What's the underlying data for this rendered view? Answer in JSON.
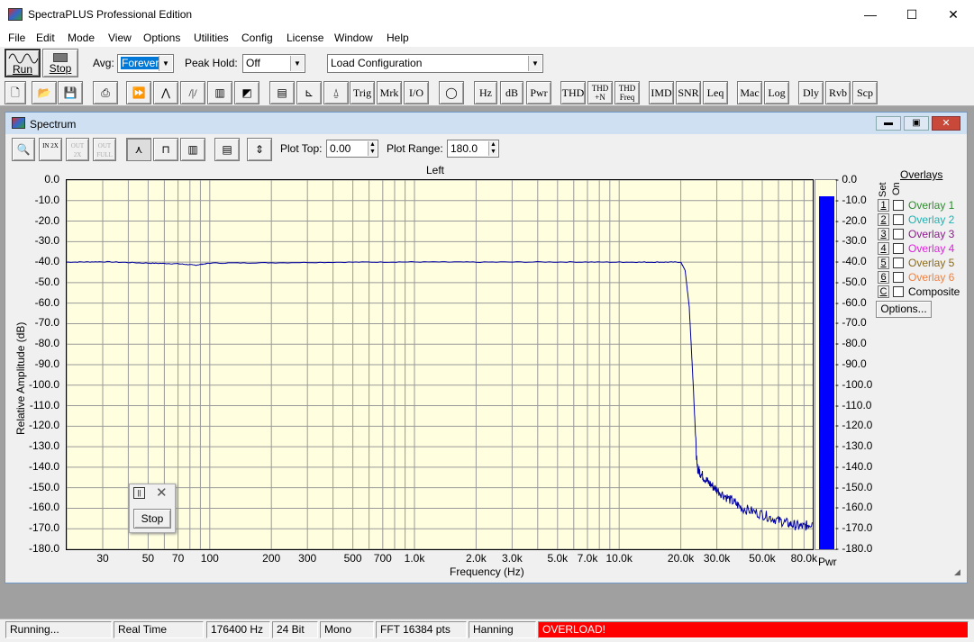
{
  "app": {
    "title": "SpectraPLUS Professional Edition",
    "minimize": "—",
    "maximize": "☐",
    "close": "✕"
  },
  "menu": [
    "File",
    "Edit",
    "Mode",
    "View",
    "Options",
    "Utilities",
    "Config",
    "License",
    "Window",
    "Help"
  ],
  "toolbar": {
    "run_label": "Run",
    "stop_label": "Stop",
    "avg_label": "Avg:",
    "avg_value": "Forever",
    "peak_hold_label": "Peak Hold:",
    "peak_hold_value": "Off",
    "config_value": "Load Configuration",
    "text_buttons": [
      "Trig",
      "Mrk",
      "I/O",
      "Hz",
      "dB",
      "Pwr",
      "THD",
      "THD\n+N",
      "THD\nFreq",
      "IMD",
      "SNR",
      "Leq",
      "Mac",
      "Log",
      "Dly",
      "Rvb",
      "Scp"
    ]
  },
  "spectrum": {
    "window_title": "Spectrum",
    "plot_top_label": "Plot Top:",
    "plot_top_value": "0.00",
    "plot_range_label": "Plot Range:",
    "plot_range_value": "180.0",
    "zoom_buttons": [
      "IN 2X",
      "OUT 2X",
      "OUT FULL"
    ],
    "chart_title": "Left",
    "pwr_label": "Pwr",
    "options_button": "Options...",
    "overlays_title": "Overlays",
    "set_label": "Set",
    "on_label": "On",
    "overlays": [
      {
        "key": "1",
        "label": "Overlay 1",
        "color": "#2e8b2e"
      },
      {
        "key": "2",
        "label": "Overlay 2",
        "color": "#20b0b0"
      },
      {
        "key": "3",
        "label": "Overlay 3",
        "color": "#8b1a8b"
      },
      {
        "key": "4",
        "label": "Overlay 4",
        "color": "#e020e0"
      },
      {
        "key": "5",
        "label": "Overlay 5",
        "color": "#8b6a1a"
      },
      {
        "key": "6",
        "label": "Overlay 6",
        "color": "#f08040"
      },
      {
        "key": "C",
        "label": "Composite",
        "color": "#000000"
      }
    ]
  },
  "floating_stop": {
    "button": "Stop"
  },
  "status": [
    "Running...",
    "Real Time",
    "176400 Hz",
    "24 Bit",
    "Mono",
    "FFT 16384 pts",
    "Hanning",
    "OVERLOAD!"
  ],
  "status_overload_color": "#ff0000",
  "chart_data": {
    "type": "line",
    "title": "Left",
    "xlabel": "Frequency (Hz)",
    "ylabel": "Relative Amplitude (dB)",
    "x_scale": "log",
    "xlim": [
      20,
      88200
    ],
    "ylim": [
      -180,
      0
    ],
    "x_ticks": [
      "30",
      "50",
      "70",
      "100",
      "200",
      "300",
      "500",
      "700",
      "1.0k",
      "2.0k",
      "3.0k",
      "5.0k",
      "7.0k",
      "10.0k",
      "20.0k",
      "30.0k",
      "50.0k",
      "80.0k"
    ],
    "x_tick_values": [
      30,
      50,
      70,
      100,
      200,
      300,
      500,
      700,
      1000,
      2000,
      3000,
      5000,
      7000,
      10000,
      20000,
      30000,
      50000,
      80000
    ],
    "y_ticks": [
      "0.0",
      "-10.0",
      "-20.0",
      "-30.0",
      "-40.0",
      "-50.0",
      "-60.0",
      "-70.0",
      "-80.0",
      "-90.0",
      "-100.0",
      "-110.0",
      "-120.0",
      "-130.0",
      "-140.0",
      "-150.0",
      "-160.0",
      "-170.0",
      "-180.0"
    ],
    "y_tick_values": [
      0,
      -10,
      -20,
      -30,
      -40,
      -50,
      -60,
      -70,
      -80,
      -90,
      -100,
      -110,
      -120,
      -130,
      -140,
      -150,
      -160,
      -170,
      -180
    ],
    "series": [
      {
        "color": "#0000a0",
        "x": [
          20,
          30,
          50,
          70,
          85,
          100,
          200,
          500,
          1000,
          2000,
          5000,
          10000,
          15000,
          20000,
          21000,
          22000,
          23000,
          24000,
          25000,
          27000,
          30000,
          35000,
          40000,
          50000,
          60000,
          70000,
          80000,
          88000
        ],
        "y": [
          -40,
          -39.8,
          -40.5,
          -40.8,
          -41.5,
          -40.5,
          -40.3,
          -40,
          -39.9,
          -40,
          -39.9,
          -40,
          -40,
          -40,
          -44,
          -62,
          -100,
          -140,
          -143,
          -147,
          -151,
          -156,
          -160,
          -163,
          -166,
          -168,
          -169,
          -167
        ]
      }
    ],
    "pwr_bar": {
      "label": "Pwr",
      "value_db": -8,
      "y_ticks": [
        "0.0",
        "-10.0",
        "-20.0",
        "-30.0",
        "-40.0",
        "-50.0",
        "-60.0",
        "-70.0",
        "-80.0",
        "-90.0",
        "-100.0",
        "-110.0",
        "-120.0",
        "-130.0",
        "-140.0",
        "-150.0",
        "-160.0",
        "-170.0",
        "-180.0"
      ]
    },
    "grid": true
  }
}
